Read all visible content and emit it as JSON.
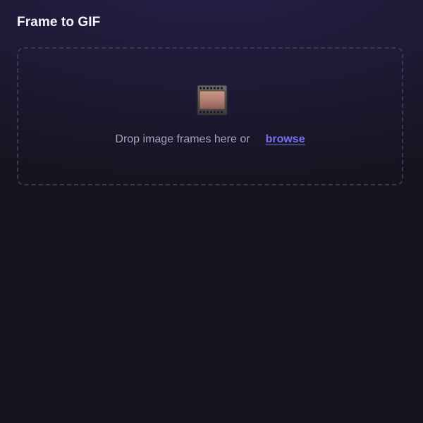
{
  "header": {
    "title": "Frame to GIF"
  },
  "drop_zone": {
    "icon": "film-frames-icon",
    "prompt": "Drop image frames here or",
    "browse_label": "browse"
  },
  "colors": {
    "background": "#141320",
    "accent": "#7c6ff0",
    "muted_text": "#a7a4c0",
    "dashed_border": "#3a3656"
  }
}
